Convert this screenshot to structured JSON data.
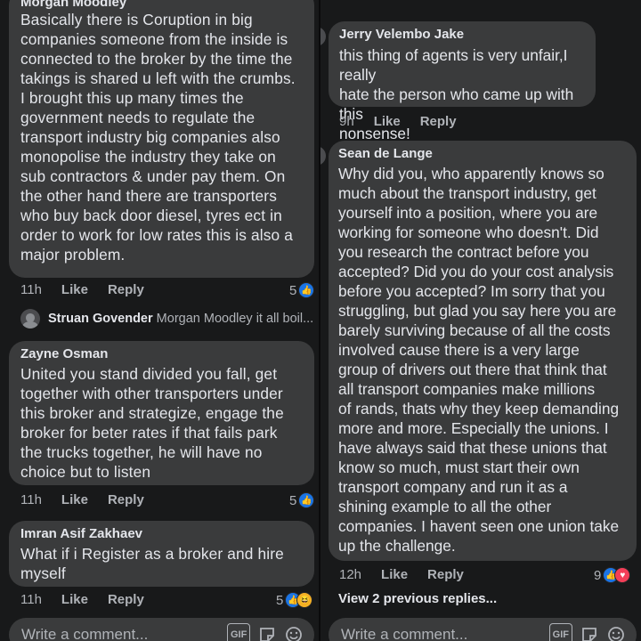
{
  "left": {
    "top_author": "Morgan Moodley",
    "comment1": {
      "text": "Basically there is Coruption in big\ncompanies someone from the inside is\nconnected to the broker by the time the\ntakings is shared u left with the crumbs.\nI brought this up many times the\ngovernment needs to regulate the\ntransport industry big companies also\nmonopolise the industry they take on\nsub contractors & under pay them. On\nthe other hand there are transporters\nwho buy back door diesel, tyres ect in\norder to work for low rates this is also a\nmajor problem.",
      "time": "11h",
      "like": "Like",
      "reply": "Reply",
      "reactions": "5"
    },
    "reply_preview": {
      "author": "Struan Govender",
      "text": "Morgan Moodley it all boil..."
    },
    "comment2": {
      "author": "Zayne Osman",
      "text": "United you stand divided you fall, get\ntogether with other transporters under\nthis broker and strategize, engage the\nbroker for beter rates if that fails park\nthe trucks together, he will have no\nchoice but to listen",
      "time": "11h",
      "like": "Like",
      "reply": "Reply",
      "reactions": "5"
    },
    "comment3": {
      "author": "Imran Asif Zakhaev",
      "text": "What if i Register as a broker and hire\nmyself",
      "time": "11h",
      "like": "Like",
      "reply": "Reply",
      "reactions": "5"
    },
    "composer": {
      "placeholder": "Write a comment...",
      "gif": "GIF"
    }
  },
  "right": {
    "comment1": {
      "author": "Jerry Velembo Jake",
      "text": "this thing of agents is very unfair,I really\nhate the person who came up with this\nnonsense!",
      "time": "9h",
      "like": "Like",
      "reply": "Reply"
    },
    "comment2": {
      "author": "Sean de Lange",
      "text": "Why did you, who apparently knows so\nmuch about the transport industry, get\nyourself into a position, where you are\nworking for someone who doesn't. Did\nyou research the contract before you\naccepted? Did you do your cost analysis\nbefore you accepted? Im sorry that you\nstruggling, but glad you say here you are\nbarely surviving because of all the costs\ninvolved cause there is a very large\ngroup of drivers out there that think that\nall transport companies make millions\nof rands, thats why they keep demanding\nmore and more. Especially the unions. I\nhave always said that these unions that\nknow so much, must start their own\ntransport company and run it as a\nshining example to all the other\ncompanies. I havent seen one union take\nup the challenge.",
      "time": "12h",
      "like": "Like",
      "reply": "Reply",
      "reactions": "9"
    },
    "view_previous": "View 2 previous replies...",
    "composer": {
      "placeholder": "Write a comment...",
      "gif": "GIF"
    }
  }
}
